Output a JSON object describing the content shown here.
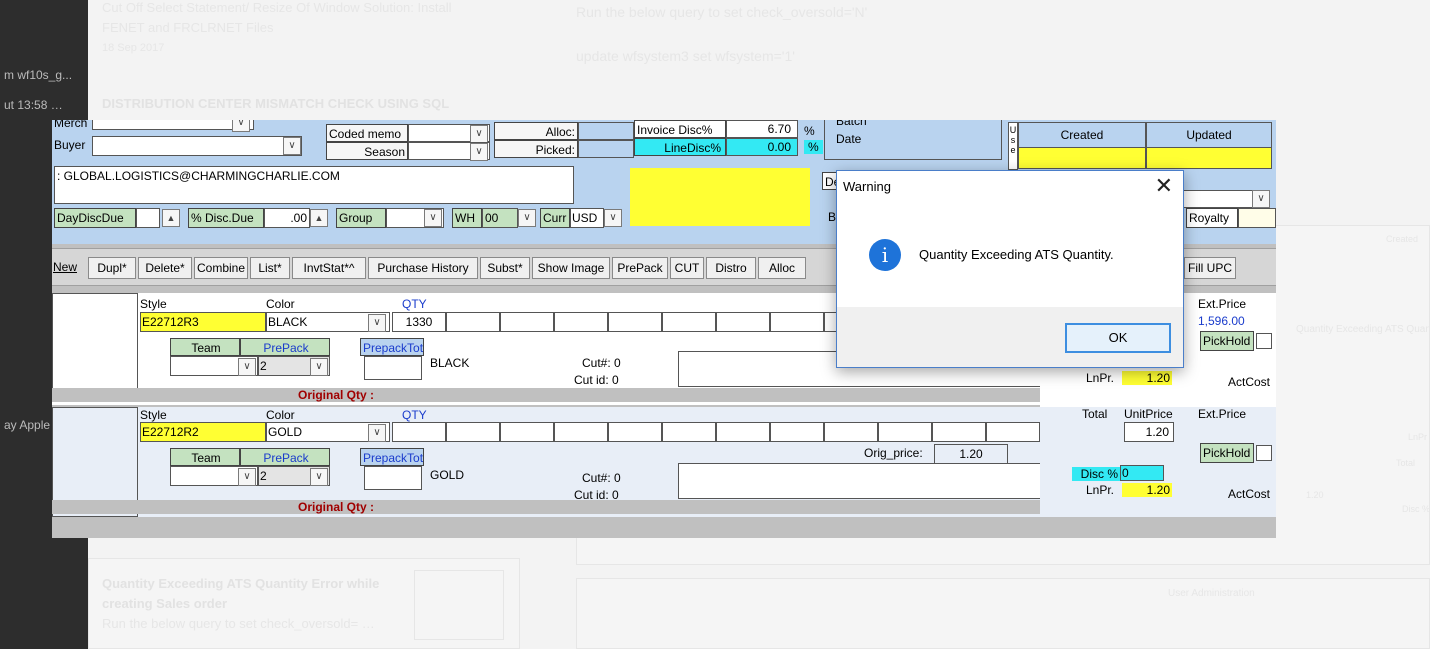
{
  "background": {
    "sidebar": [
      "m wf10s_g...",
      "ut 13:58 …",
      "ay Apple …"
    ],
    "article1_title": "Cut Off Select Statement/ Resize Of Window Solution: Install",
    "article1_title2": "FENET and FRCLRNET Files",
    "article1_date": "18 Sep 2017",
    "article2_title": "DISTRIBUTION CENTER MISMATCH CHECK USING SQL",
    "right_text1": "Run the below query to set check_oversold='N'",
    "right_text2": "update wfsystem3 set wfsystem='1'",
    "article3_title": "Quantity Exceeding ATS Quantity Error while",
    "article3_title2": "creating Sales order",
    "article3_snippet": "Run the below query to set check_oversold= …",
    "right_bg_dialog": "Quantity Exceeding ATS Quan",
    "right_bg_created": "Created",
    "right_bg_total": "Total",
    "right_bg_price": "1.20",
    "right_bg_lnpr": "LnPr",
    "right_bg_disc": "Disc %",
    "right_bg_admin": "User Administration"
  },
  "app": {
    "merch_label": "Merch",
    "buyer_label": "Buyer",
    "coded_memo_label": "Coded memo",
    "season_label": "Season",
    "alloc_label": "Alloc:",
    "picked_label": "Picked:",
    "invoice_disc_label": "Invoice Disc%",
    "invoice_disc_value": "6.70",
    "line_disc_label": "LineDisc%",
    "line_disc_value": "0.00",
    "pct1": "%",
    "pct2": "%",
    "batch_label": "Batch",
    "date_label": "Date",
    "use_label": "U s e",
    "created_header": "Created",
    "updated_header": "Updated",
    "email": ": GLOBAL.LOGISTICS@CHARMINGCHARLIE.COM",
    "day_disc_due": "DayDiscDue",
    "pct_disc_due": "% Disc.Due",
    "disc_due_value": ".00",
    "group_label": "Group",
    "wh_label": "WH",
    "wh_value": "00",
    "curr_label": "Curr",
    "curr_value": "USD",
    "de_label": "De",
    "b_label": "B",
    "royalty_label": "Royalty",
    "toolbar": [
      "New",
      "Dupl*",
      "Delete*",
      "Combine",
      "List*",
      "InvtStat*^",
      "Purchase History",
      "Subst*",
      "Show Image",
      "PrePack",
      "CUT",
      "Distro",
      "Alloc"
    ],
    "fill_upc": "Fill UPC"
  },
  "lines": [
    {
      "style_label": "Style",
      "color_label": "Color",
      "qty_label": "QTY",
      "style": "E22712R3",
      "color": "BLACK",
      "qty": "1330",
      "team_label": "Team",
      "prepack_label": "PrePack",
      "prepack_value": "2",
      "prepacktot_label": "PrepackTot",
      "color_text": "BLACK",
      "cut_no": "Cut#: 0",
      "cut_id": "Cut id: 0",
      "original_qty": "Original Qty :",
      "ext_price_label": "Ext.Price",
      "ext_price": "1,596.00",
      "pickhold": "PickHold",
      "lnpr_label": "LnPr.",
      "lnpr_value": "1.20",
      "actcost": "ActCost"
    },
    {
      "style_label": "Style",
      "color_label": "Color",
      "qty_label": "QTY",
      "style": "E22712R2",
      "color": "GOLD",
      "qty": "",
      "team_label": "Team",
      "prepack_label": "PrePack",
      "prepack_value": "2",
      "prepacktot_label": "PrepackTot",
      "color_text": "GOLD",
      "cut_no": "Cut#: 0",
      "cut_id": "Cut id: 0",
      "original_qty": "Original Qty :",
      "total_label": "Total",
      "unit_price_label": "UnitPrice",
      "unit_price": "1.20",
      "ext_price_label": "Ext.Price",
      "orig_price_label": "Orig_price:",
      "orig_price": "1.20",
      "pickhold": "PickHold",
      "disc_label": "Disc %",
      "disc_value": "0",
      "lnpr_label": "LnPr.",
      "lnpr_value": "1.20",
      "actcost": "ActCost"
    }
  ],
  "dialog": {
    "title": "Warning",
    "message": "Quantity Exceeding ATS Quantity.",
    "ok_label": "OK",
    "close_glyph": "✕",
    "icon_glyph": "i"
  }
}
